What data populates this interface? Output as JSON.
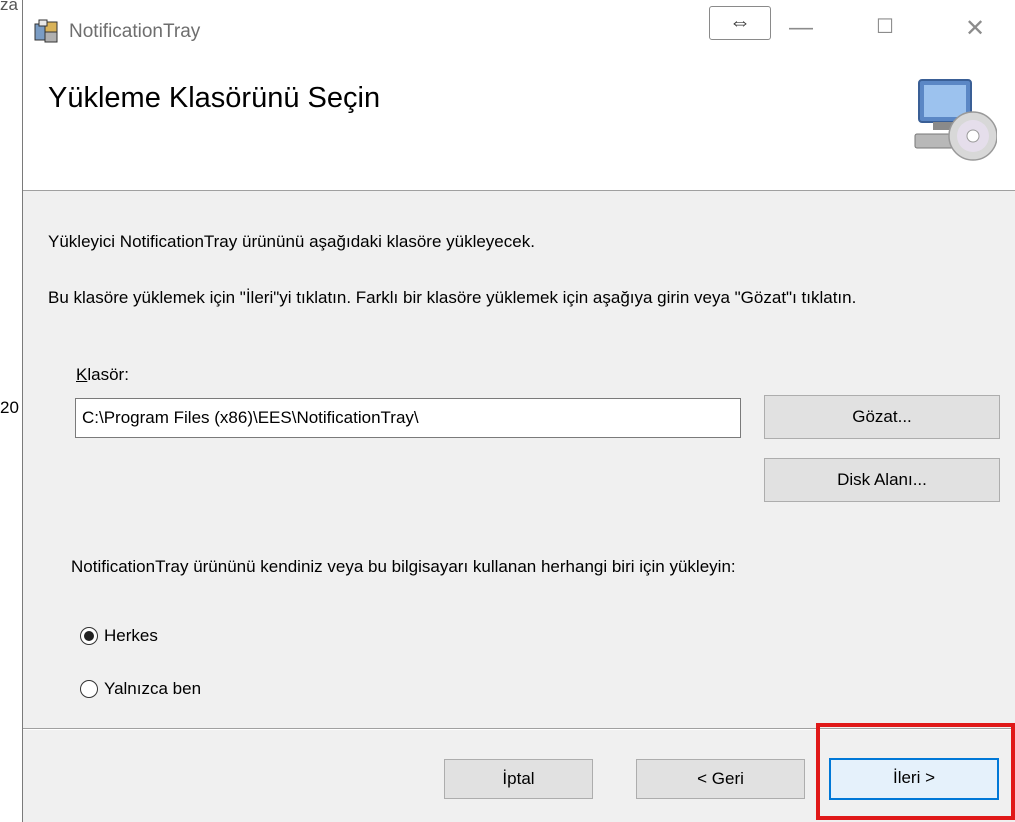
{
  "background": {
    "top_fragment": "za",
    "side_fragment": "20"
  },
  "window": {
    "title": "NotificationTray",
    "controls": {
      "resize_symbol": "⇔",
      "minimize_symbol": "—",
      "maximize_symbol": "☐",
      "close_symbol": "✕"
    }
  },
  "header": {
    "title": "Yükleme Klasörünü Seçin"
  },
  "body": {
    "description_1": "Yükleyici NotificationTray ürününü aşağıdaki klasöre yükleyecek.",
    "description_2": "Bu klasöre yüklemek için \"İleri\"yi tıklatın. Farklı bir klasöre yüklemek için aşağıya girin veya \"Gözat\"ı tıklatın.",
    "folder_label_hotkey": "K",
    "folder_label_rest": "lasör:",
    "folder_value": "C:\\Program Files (x86)\\EES\\NotificationTray\\",
    "browse_button": "Gözat...",
    "disk_space_button": "Disk Alanı...",
    "install_for_prompt": "NotificationTray ürününü kendiniz veya bu bilgisayarı kullanan herhangi biri için yükleyin:",
    "radio_options": [
      {
        "label": "Herkes",
        "checked": true
      },
      {
        "label": "Yalnızca ben",
        "checked": false
      }
    ]
  },
  "footer": {
    "cancel_button": "İptal",
    "back_button": "< Geri",
    "next_button": "İleri >"
  },
  "colors": {
    "highlight": "#e01818",
    "focus_border": "#0078d7"
  }
}
